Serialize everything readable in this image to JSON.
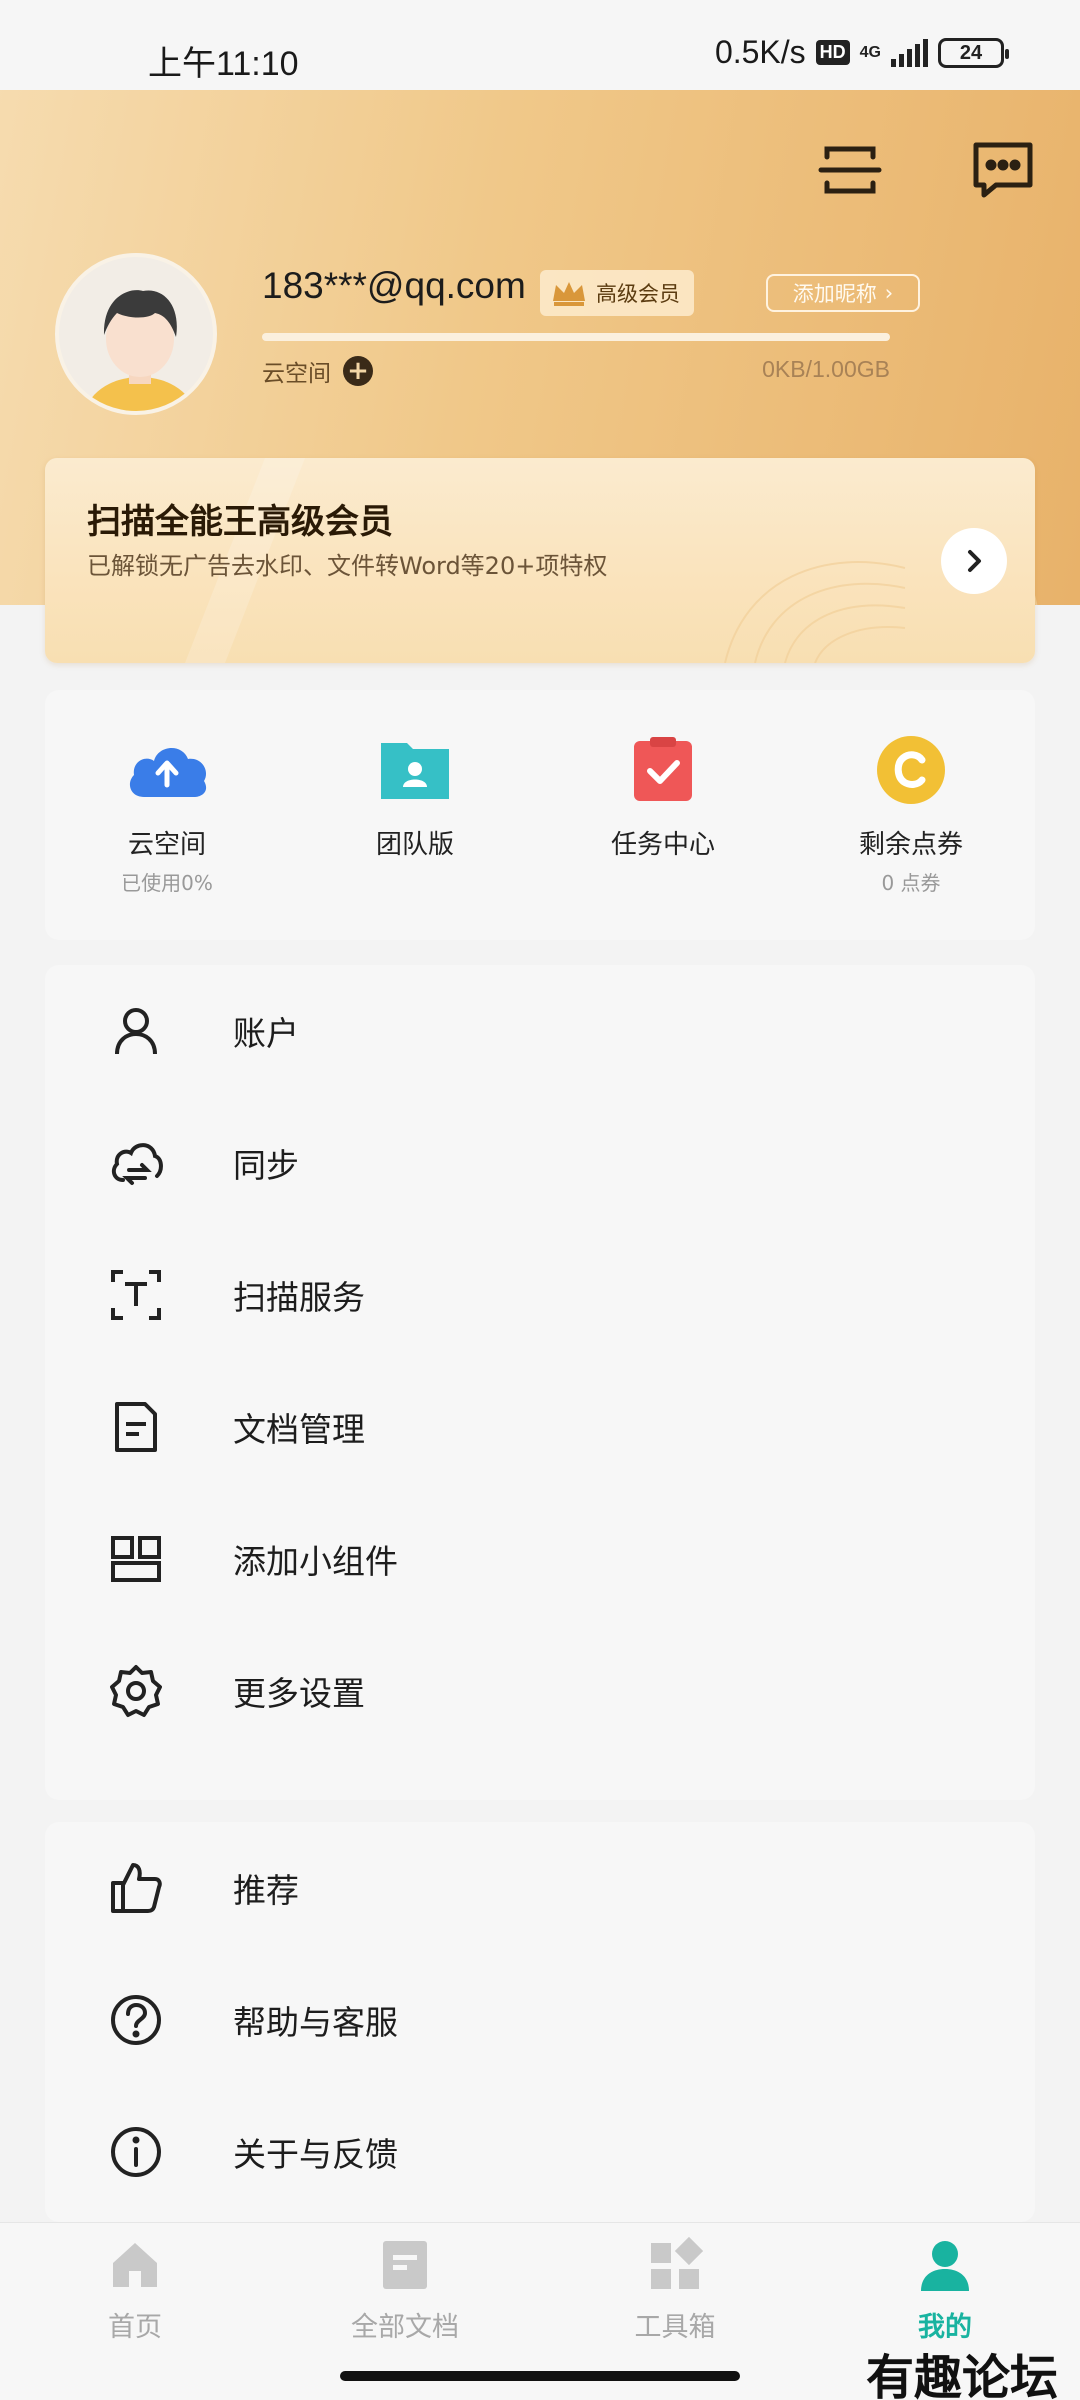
{
  "status_bar": {
    "time": "上午11:10",
    "net_speed": "0.5K/s",
    "hd": "HD",
    "network": "4G",
    "battery": "24"
  },
  "header": {
    "scan_icon": "scan-icon",
    "message_icon": "message-icon"
  },
  "profile": {
    "email": "183***@qq.com",
    "vip_badge": "高级会员",
    "add_nickname": "添加昵称",
    "cloud_label": "云空间",
    "storage": "0KB/1.00GB",
    "storage_used_fraction": 0.0
  },
  "vip_card": {
    "title": "扫描全能王高级会员",
    "desc": "已解锁无广告去水印、文件转Word等20+项特权"
  },
  "quick": [
    {
      "label": "云空间",
      "sub": "已使用0%",
      "icon": "cloud-upload-icon",
      "color": "#3a7de8"
    },
    {
      "label": "团队版",
      "sub": "",
      "icon": "team-folder-icon",
      "color": "#36c0c6"
    },
    {
      "label": "任务中心",
      "sub": "",
      "icon": "task-check-icon",
      "color": "#ef5757"
    },
    {
      "label": "剩余点券",
      "sub": "0 点券",
      "icon": "coupon-coin-icon",
      "color": "#f2c035"
    }
  ],
  "menu1": [
    {
      "label": "账户",
      "icon": "user-icon"
    },
    {
      "label": "同步",
      "icon": "cloud-sync-icon"
    },
    {
      "label": "扫描服务",
      "icon": "scan-text-icon"
    },
    {
      "label": "文档管理",
      "icon": "document-icon"
    },
    {
      "label": "添加小组件",
      "icon": "widget-icon"
    },
    {
      "label": "更多设置",
      "icon": "gear-icon"
    }
  ],
  "menu2": [
    {
      "label": "推荐",
      "icon": "thumbs-up-icon"
    },
    {
      "label": "帮助与客服",
      "icon": "help-icon"
    },
    {
      "label": "关于与反馈",
      "icon": "info-icon"
    }
  ],
  "tabs": [
    {
      "label": "首页",
      "icon": "home-icon",
      "active": false
    },
    {
      "label": "全部文档",
      "icon": "all-docs-icon",
      "active": false
    },
    {
      "label": "工具箱",
      "icon": "toolbox-icon",
      "active": false
    },
    {
      "label": "我的",
      "icon": "me-icon",
      "active": true
    }
  ],
  "accent_color": "#19b3a0",
  "watermark": "有趣论坛"
}
